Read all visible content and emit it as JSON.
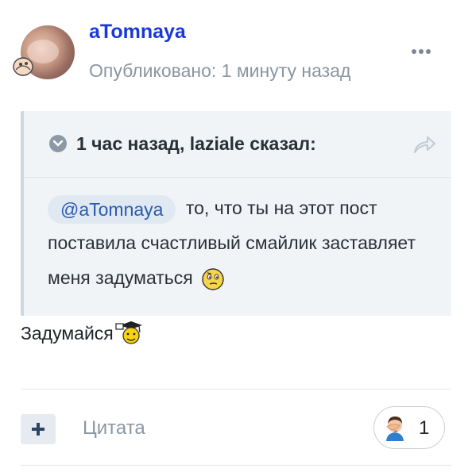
{
  "post": {
    "username": "aTomnaya",
    "published": "Опубликовано: 1 минуту назад"
  },
  "quote": {
    "title": "1 час назад, laziale сказал:",
    "mention": "@aTomnaya",
    "text": "то, что ты на этот пост поставила счастливый смайлик заставляет меня задуматься"
  },
  "reply": {
    "text": "Задумайся"
  },
  "footer": {
    "quote_label": "Цитата",
    "reaction_count": "1"
  },
  "icons": {
    "more": "more-dots-icon",
    "collapse": "chevron-down-icon",
    "share": "share-arrow-icon",
    "add": "plus-icon",
    "reaction": "facepalm-emoji"
  },
  "colors": {
    "username": "#1a38d8",
    "muted": "#8a95a3",
    "quote_bg": "#f1f4f7",
    "mention_bg": "#e0e8f2",
    "mention_text": "#2b5bb0"
  }
}
